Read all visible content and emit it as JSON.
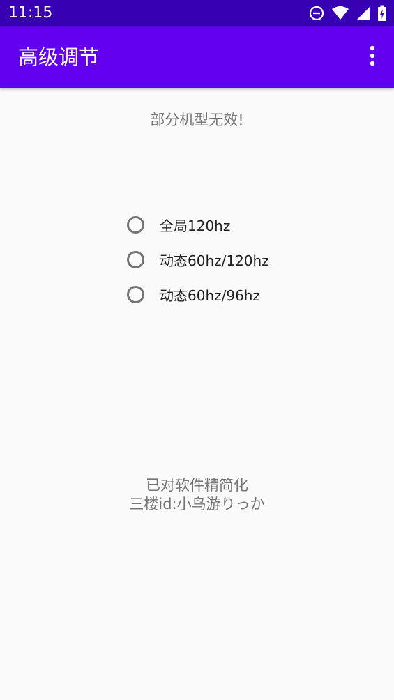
{
  "status_bar": {
    "time": "11:15",
    "icons": [
      "do-not-disturb-icon",
      "wifi-icon",
      "signal-icon",
      "battery-charging-icon"
    ]
  },
  "app_bar": {
    "title": "高级调节",
    "menu_icon": "more-vert-icon"
  },
  "notice": "部分机型无效!",
  "refresh_options": [
    {
      "label": "全局120hz",
      "checked": false
    },
    {
      "label": "动态60hz/120hz",
      "checked": false
    },
    {
      "label": "动态60hz/96hz",
      "checked": false
    }
  ],
  "credits": {
    "line1": "已对软件精简化",
    "line2": "三楼id:小鸟游りっか"
  },
  "colors": {
    "status_bar": "#3700b3",
    "app_bar": "#6200ee",
    "background": "#fafafa",
    "radio_outline": "#737373",
    "secondary_text": "#757575"
  }
}
